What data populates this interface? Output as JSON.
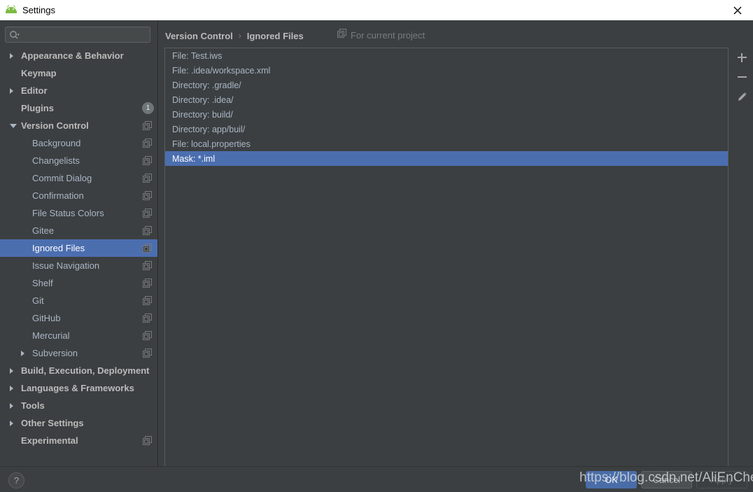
{
  "window": {
    "title": "Settings",
    "logo_icon": "android-logo-icon",
    "close_icon": "close-icon"
  },
  "search": {
    "placeholder": "",
    "value": "",
    "icon": "search-icon"
  },
  "sidebar": {
    "items": [
      {
        "label": "Appearance & Behavior",
        "level": "top",
        "arrow": "collapsed",
        "copy": false,
        "badge": null,
        "selected": false
      },
      {
        "label": "Keymap",
        "level": "top",
        "arrow": "none",
        "copy": false,
        "badge": null,
        "selected": false
      },
      {
        "label": "Editor",
        "level": "top",
        "arrow": "collapsed",
        "copy": false,
        "badge": null,
        "selected": false
      },
      {
        "label": "Plugins",
        "level": "top",
        "arrow": "none",
        "copy": false,
        "badge": "1",
        "selected": false
      },
      {
        "label": "Version Control",
        "level": "top",
        "arrow": "expanded",
        "copy": true,
        "badge": null,
        "selected": false
      },
      {
        "label": "Background",
        "level": "child",
        "arrow": "none",
        "copy": true,
        "badge": null,
        "selected": false
      },
      {
        "label": "Changelists",
        "level": "child",
        "arrow": "none",
        "copy": true,
        "badge": null,
        "selected": false
      },
      {
        "label": "Commit Dialog",
        "level": "child",
        "arrow": "none",
        "copy": true,
        "badge": null,
        "selected": false
      },
      {
        "label": "Confirmation",
        "level": "child",
        "arrow": "none",
        "copy": true,
        "badge": null,
        "selected": false
      },
      {
        "label": "File Status Colors",
        "level": "child",
        "arrow": "none",
        "copy": true,
        "badge": null,
        "selected": false
      },
      {
        "label": "Gitee",
        "level": "child",
        "arrow": "none",
        "copy": true,
        "badge": null,
        "selected": false
      },
      {
        "label": "Ignored Files",
        "level": "child",
        "arrow": "none",
        "copy": true,
        "badge": null,
        "selected": true
      },
      {
        "label": "Issue Navigation",
        "level": "child",
        "arrow": "none",
        "copy": true,
        "badge": null,
        "selected": false
      },
      {
        "label": "Shelf",
        "level": "child",
        "arrow": "none",
        "copy": true,
        "badge": null,
        "selected": false
      },
      {
        "label": "Git",
        "level": "child",
        "arrow": "none",
        "copy": true,
        "badge": null,
        "selected": false
      },
      {
        "label": "GitHub",
        "level": "child",
        "arrow": "none",
        "copy": true,
        "badge": null,
        "selected": false
      },
      {
        "label": "Mercurial",
        "level": "child",
        "arrow": "none",
        "copy": true,
        "badge": null,
        "selected": false
      },
      {
        "label": "Subversion",
        "level": "child",
        "arrow": "collapsed",
        "copy": true,
        "badge": null,
        "selected": false
      },
      {
        "label": "Build, Execution, Deployment",
        "level": "top",
        "arrow": "collapsed",
        "copy": false,
        "badge": null,
        "selected": false
      },
      {
        "label": "Languages & Frameworks",
        "level": "top",
        "arrow": "collapsed",
        "copy": false,
        "badge": null,
        "selected": false
      },
      {
        "label": "Tools",
        "level": "top",
        "arrow": "collapsed",
        "copy": false,
        "badge": null,
        "selected": false
      },
      {
        "label": "Other Settings",
        "level": "top",
        "arrow": "collapsed",
        "copy": false,
        "badge": null,
        "selected": false
      },
      {
        "label": "Experimental",
        "level": "top",
        "arrow": "none",
        "copy": true,
        "badge": null,
        "selected": false
      }
    ]
  },
  "content": {
    "breadcrumb": {
      "parent": "Version Control",
      "separator": "›",
      "current": "Ignored Files"
    },
    "scope": {
      "icon": "copy-icon",
      "text": "For current project"
    },
    "ignored_files": [
      {
        "text": "File: Test.iws",
        "selected": false
      },
      {
        "text": "File: .idea/workspace.xml",
        "selected": false
      },
      {
        "text": "Directory: .gradle/",
        "selected": false
      },
      {
        "text": "Directory: .idea/",
        "selected": false
      },
      {
        "text": "Directory: build/",
        "selected": false
      },
      {
        "text": "Directory: app/buil/",
        "selected": false
      },
      {
        "text": "File: local.properties",
        "selected": false
      },
      {
        "text": "Mask: *.iml",
        "selected": true
      }
    ],
    "toolbar": [
      {
        "name": "add-button",
        "icon": "plus-icon",
        "title": "Add"
      },
      {
        "name": "remove-button",
        "icon": "minus-icon",
        "title": "Remove"
      },
      {
        "name": "edit-button",
        "icon": "pencil-icon",
        "title": "Edit"
      }
    ]
  },
  "footer": {
    "help_label": "?",
    "ok_label": "OK",
    "cancel_label": "Cancel",
    "apply_label": "Apply"
  },
  "watermark": {
    "text": "https://blog.csdn.net/AliEnCheng"
  },
  "colors": {
    "selection_blue": "#4b6eaf",
    "primary_button": "#4a6da7",
    "panel_bg": "#3c3f41",
    "text": "#a9b7c6"
  }
}
